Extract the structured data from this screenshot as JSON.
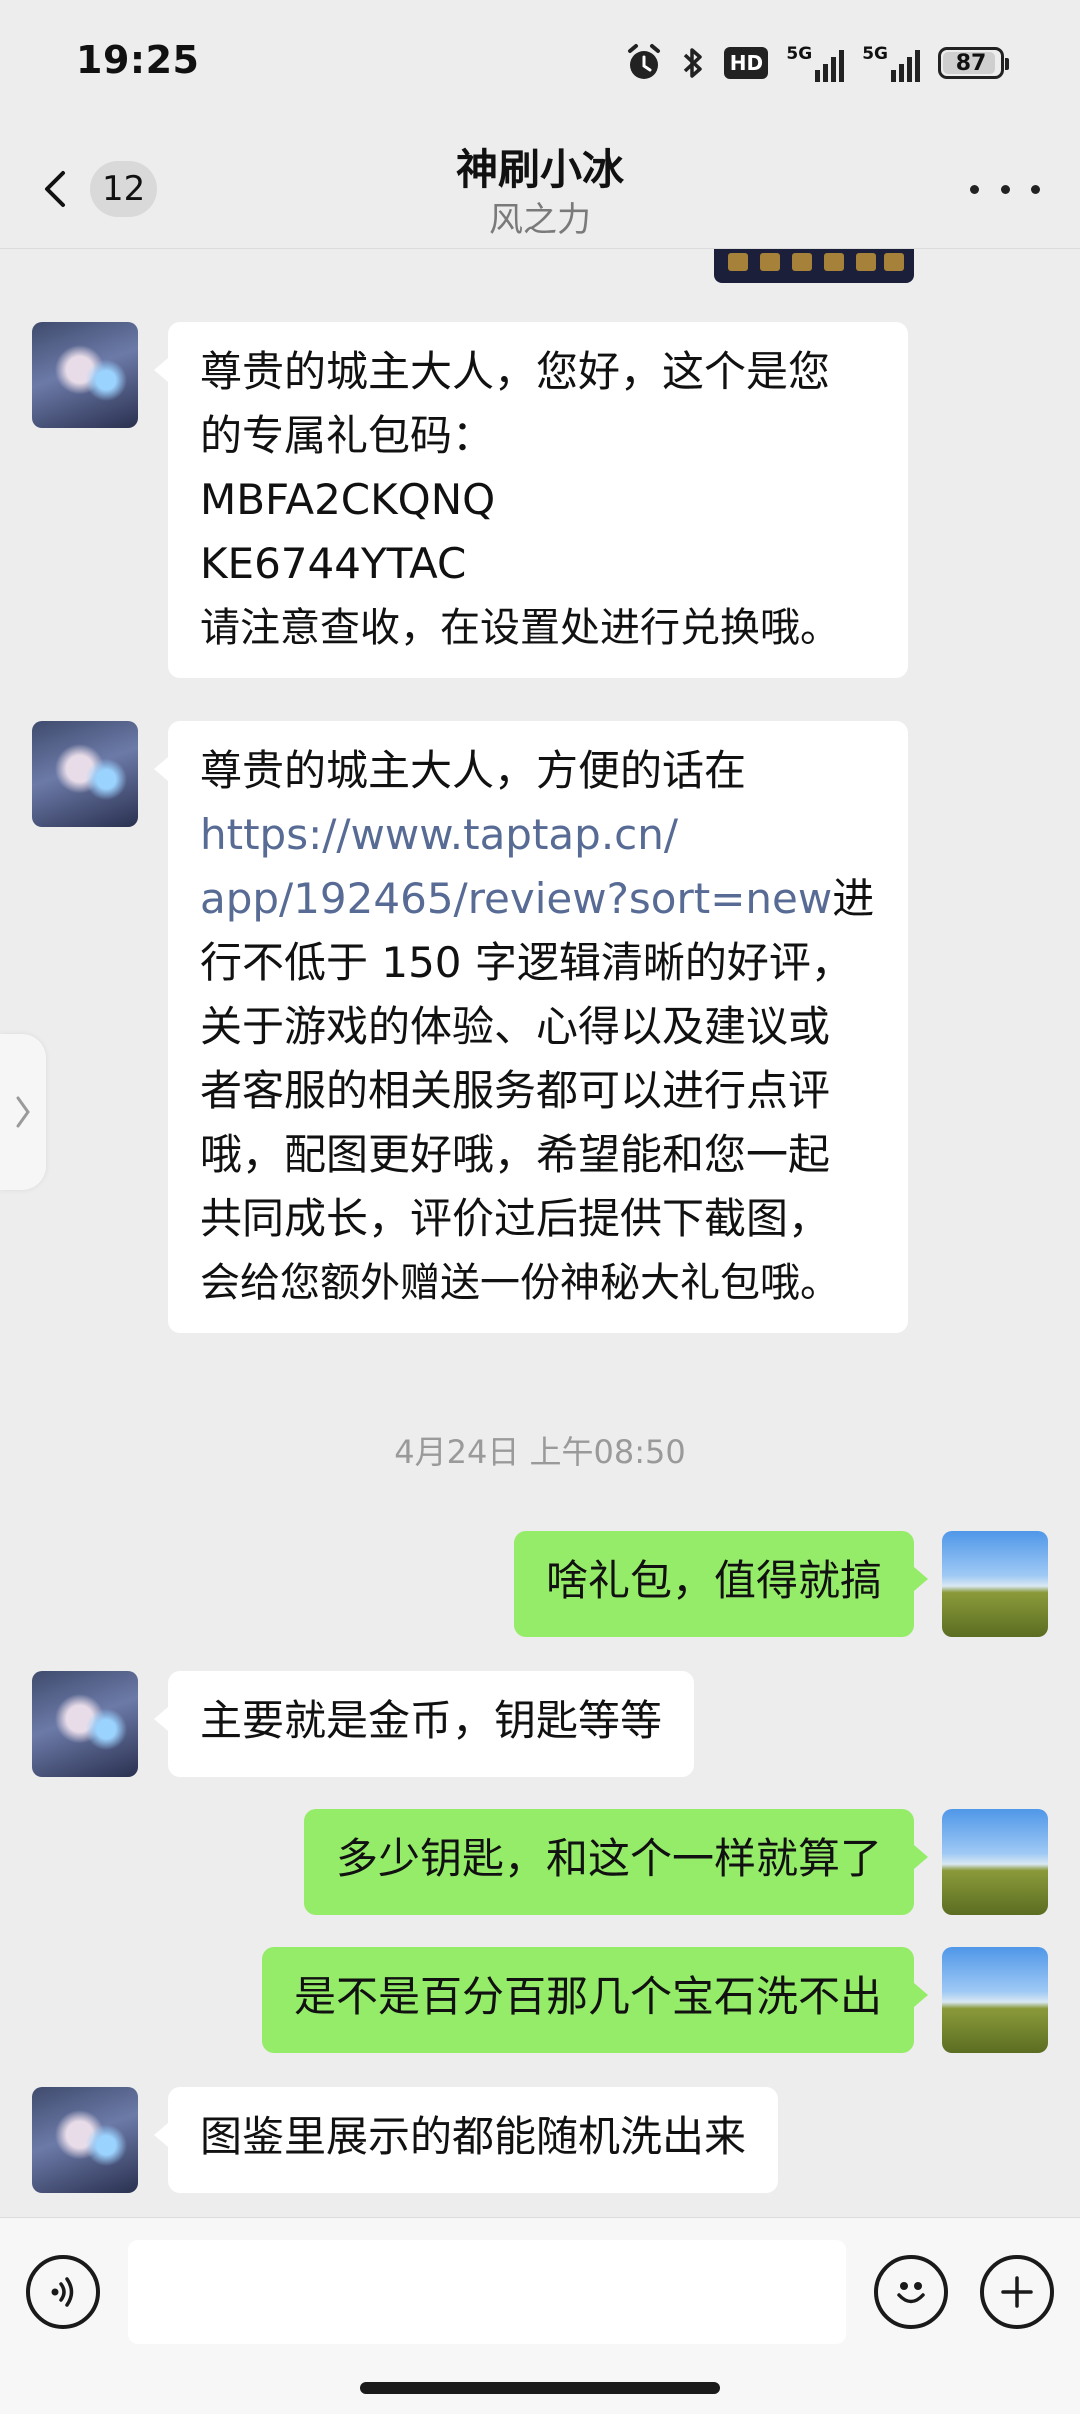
{
  "status_bar": {
    "time": "19:25",
    "icons": [
      "alarm-icon",
      "bluetooth-icon",
      "hd-icon",
      "signal-5g-icon",
      "signal-5g-icon"
    ],
    "hd_label": "HD",
    "network_label": "5G",
    "battery": "87"
  },
  "header": {
    "unread_count": "12",
    "title": "神刷小冰",
    "subtitle": "风之力"
  },
  "messages": {
    "m1": {
      "lines": [
        "尊贵的城主大人，您好，这个是您",
        "的专属礼包码：",
        "MBFA2CKQNQ",
        "KE6744YTAC",
        "请注意查收，在设置处进行兑换哦。"
      ]
    },
    "m2": {
      "line1": "尊贵的城主大人，方便的话在",
      "link_line1": "https://www.taptap.cn/",
      "link_line2": "app/192465/review?sort=new",
      "link_suffix": "进",
      "rest": [
        "行不低于 150 字逻辑清晰的好评，",
        "关于游戏的体验、心得以及建议或",
        "者客服的相关服务都可以进行点评",
        "哦，配图更好哦，希望能和您一起",
        "共同成长，评价过后提供下截图，",
        "会给您额外赠送一份神秘大礼包哦。"
      ]
    },
    "timestamp": "4月24日 上午08:50",
    "m3": "啥礼包，值得就搞",
    "m4": "主要就是金币，钥匙等等",
    "m5": "多少钥匙，和这个一样就算了",
    "m6": "是不是百分百那几个宝石洗不出",
    "m7": "图鉴里展示的都能随机洗出来"
  },
  "input": {
    "placeholder": ""
  },
  "colors": {
    "background": "#ededed",
    "incoming_bubble": "#ffffff",
    "outgoing_bubble": "#95ec69",
    "link": "#576b95"
  }
}
